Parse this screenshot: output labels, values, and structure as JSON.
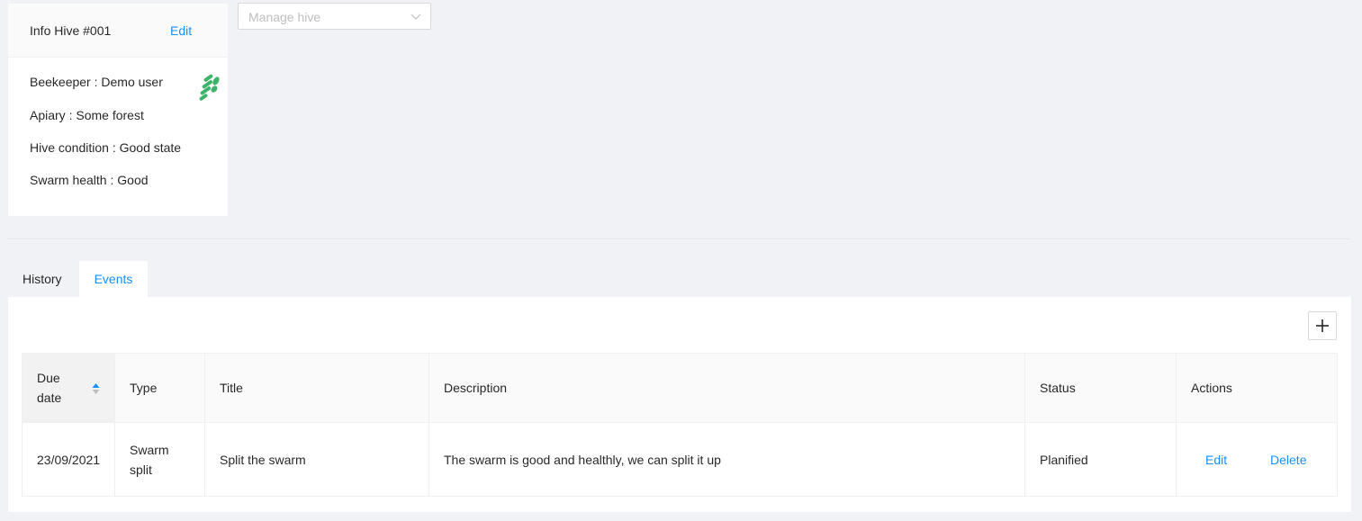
{
  "info": {
    "title": "Info Hive #001",
    "edit_label": "Edit",
    "lines": [
      "Beekeeper : Demo user",
      "Apiary : Some forest",
      "Hive condition : Good state",
      "Swarm health : Good"
    ],
    "icon": "bee-icon"
  },
  "manage": {
    "placeholder": "Manage hive"
  },
  "tabs": [
    "History",
    "Events"
  ],
  "table": {
    "headers": [
      "Due date",
      "Type",
      "Title",
      "Description",
      "Status",
      "Actions"
    ],
    "rows": [
      {
        "due_date": "23/09/2021",
        "type": "Swarm split",
        "title": "Split the swarm",
        "description": "The swarm is good and healthly, we can split it up",
        "status": "Planified",
        "edit": "Edit",
        "delete": "Delete"
      }
    ]
  },
  "colors": {
    "accent": "#1890ff",
    "bee": "#3bb36a",
    "background": "#f0f2f5"
  }
}
